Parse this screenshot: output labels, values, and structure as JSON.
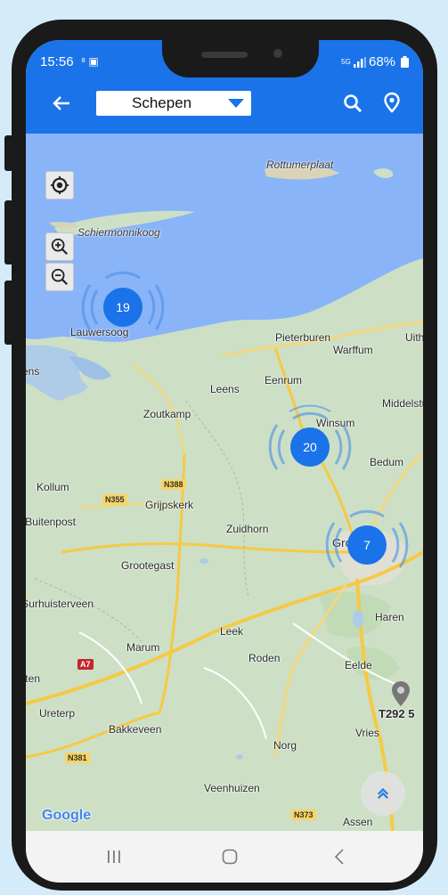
{
  "status": {
    "time": "15:56",
    "signal": "5G",
    "battery": "68%"
  },
  "appbar": {
    "title_selected": "Schepen"
  },
  "map": {
    "labels": [
      "Rottumerplaat",
      "Schiermonnikoog",
      "Lauwersoog",
      "Pieterburen",
      "Warffum",
      "Uithuizen",
      "Leens",
      "Eenrum",
      "Middelstum",
      "Zoutkamp",
      "Winsum",
      "Bedum",
      "Kollum",
      "Grijpskerk",
      "Zuidhorn",
      "Groningen",
      "Buitenpost",
      "Grootegast",
      "Surhuisterveen",
      "Haren",
      "Leek",
      "Marum",
      "Roden",
      "Eelde",
      "Ureterp",
      "Bakkeveen",
      "Vries",
      "Norg",
      "Veenhuizen",
      "Assen",
      "Drachten"
    ],
    "road_labels": [
      "N355",
      "N388",
      "A7",
      "N381",
      "N373"
    ],
    "clusters": [
      {
        "count": "19"
      },
      {
        "count": "20"
      },
      {
        "count": "7"
      }
    ],
    "pin_label": "T292 5",
    "attribution": "Google"
  },
  "colors": {
    "primary": "#1a73e8",
    "land": "#cde0c6",
    "water": "#8ab4f8"
  }
}
